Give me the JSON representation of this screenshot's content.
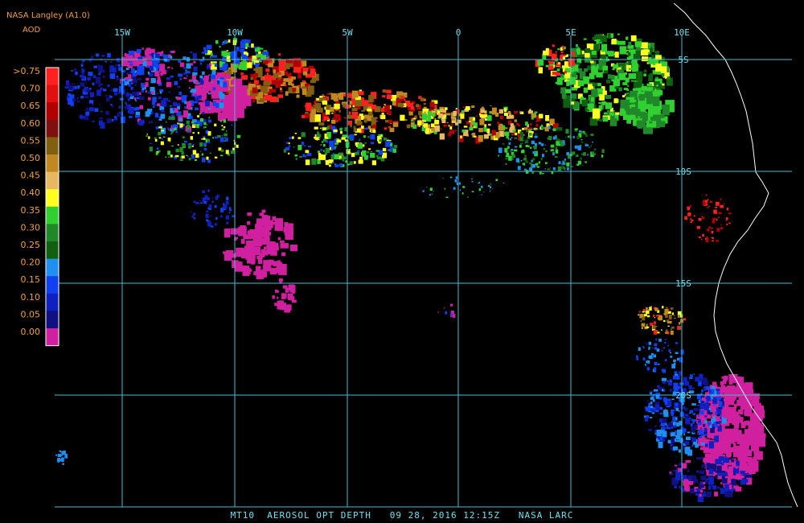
{
  "header": {
    "product": "NASA Langley (A1.0)",
    "variable": "AOD"
  },
  "colorbar": {
    "labels": [
      ">0.75",
      "0.70",
      "0.65",
      "0.60",
      "0.55",
      "0.50",
      "0.45",
      "0.40",
      "0.35",
      "0.30",
      "0.25",
      "0.20",
      "0.15",
      "0.10",
      "0.05",
      "0.00"
    ],
    "colors": [
      "#ff2020",
      "#e01010",
      "#b00000",
      "#801010",
      "#806010",
      "#c08820",
      "#e8b860",
      "#ffff20",
      "#30d030",
      "#208828",
      "#106010",
      "#2090f0",
      "#1040f0",
      "#1020c0",
      "#101080",
      "#d020a0"
    ]
  },
  "grid": {
    "lon_labels": [
      "15W",
      "10W",
      "5W",
      "0",
      "5E",
      "10E"
    ],
    "lat_labels": [
      "5S",
      "10S",
      "15S",
      "20S"
    ]
  },
  "footer": {
    "text": "MT10  AEROSOL OPT DEPTH   09 28, 2016 12:15Z   NASA LARC"
  },
  "colors": {
    "grid": "#40c0d0",
    "coast": "#ffffff",
    "label": "#f0a040"
  }
}
